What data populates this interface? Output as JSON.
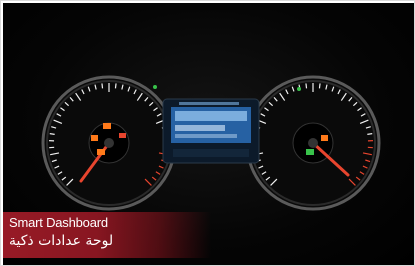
{
  "caption": {
    "title_en": "Smart Dashboard",
    "title_ar": "لوحة عدادات ذكية"
  },
  "colors": {
    "caption_red": "#a01c28",
    "needle_red": "#e8452e",
    "warning_orange": "#ff7a1a",
    "indicator_green": "#38c24a",
    "screen_blue": "#3fa0ff"
  },
  "icons": [
    "tachometer-gauge",
    "speedometer-gauge",
    "warning-lights",
    "info-display"
  ]
}
